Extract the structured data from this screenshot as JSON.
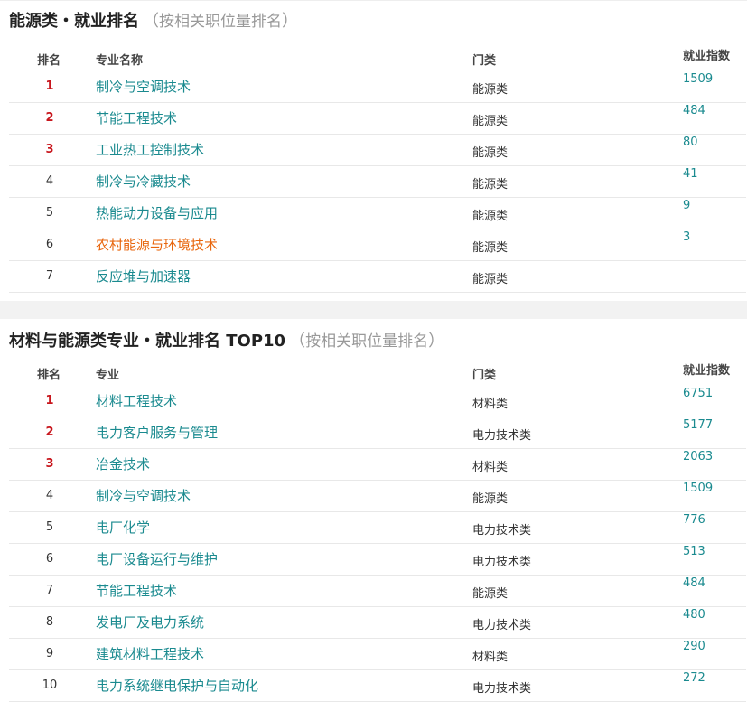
{
  "section1": {
    "title": "能源类・就业排名",
    "subtitle_open": "（",
    "subtitle": "按相关职位量排名",
    "subtitle_close": "）",
    "headers": {
      "rank": "排名",
      "major": "专业名称",
      "category": "门类",
      "index": "就业指数"
    },
    "rows": [
      {
        "rank": "1",
        "major": "制冷与空调技术",
        "category": "能源类",
        "index": "1509"
      },
      {
        "rank": "2",
        "major": "节能工程技术",
        "category": "能源类",
        "index": "484"
      },
      {
        "rank": "3",
        "major": "工业热工控制技术",
        "category": "能源类",
        "index": "80"
      },
      {
        "rank": "4",
        "major": "制冷与冷藏技术",
        "category": "能源类",
        "index": "41"
      },
      {
        "rank": "5",
        "major": "热能动力设备与应用",
        "category": "能源类",
        "index": "9"
      },
      {
        "rank": "6",
        "major": "农村能源与环境技术",
        "category": "能源类",
        "index": "3"
      },
      {
        "rank": "7",
        "major": "反应堆与加速器",
        "category": "能源类",
        "index": ""
      }
    ]
  },
  "section2": {
    "title": "材料与能源类专业・就业排名 TOP10",
    "subtitle_open": "（",
    "subtitle": "按相关职位量排名",
    "subtitle_close": "）",
    "headers": {
      "rank": "排名",
      "major": "专业",
      "category": "门类",
      "index": "就业指数"
    },
    "rows": [
      {
        "rank": "1",
        "major": "材料工程技术",
        "category": "材料类",
        "index": "6751"
      },
      {
        "rank": "2",
        "major": "电力客户服务与管理",
        "category": "电力技术类",
        "index": "5177"
      },
      {
        "rank": "3",
        "major": "冶金技术",
        "category": "材料类",
        "index": "2063"
      },
      {
        "rank": "4",
        "major": "制冷与空调技术",
        "category": "能源类",
        "index": "1509"
      },
      {
        "rank": "5",
        "major": "电厂化学",
        "category": "电力技术类",
        "index": "776"
      },
      {
        "rank": "6",
        "major": "电厂设备运行与维护",
        "category": "电力技术类",
        "index": "513"
      },
      {
        "rank": "7",
        "major": "节能工程技术",
        "category": "能源类",
        "index": "484"
      },
      {
        "rank": "8",
        "major": "发电厂及电力系统",
        "category": "电力技术类",
        "index": "480"
      },
      {
        "rank": "9",
        "major": "建筑材料工程技术",
        "category": "材料类",
        "index": "290"
      },
      {
        "rank": "10",
        "major": "电力系统继电保护与自动化",
        "category": "电力技术类",
        "index": "272"
      }
    ]
  },
  "colors": {
    "link": "#1a8a8f",
    "top_rank": "#c8161d",
    "highlight": "#e8650c",
    "divider": "#f2f2f2"
  }
}
